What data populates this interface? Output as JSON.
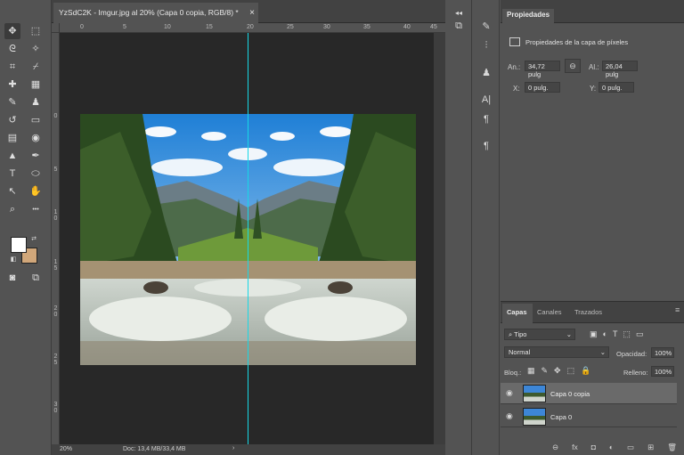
{
  "toolbar": {
    "tools": [
      {
        "id": "move",
        "glyph": "✥"
      },
      {
        "id": "artboard",
        "glyph": "⬚"
      },
      {
        "id": "lasso",
        "glyph": "ᘓ"
      },
      {
        "id": "magic-wand",
        "glyph": "✧"
      },
      {
        "id": "crop",
        "glyph": "⌗"
      },
      {
        "id": "eyedropper",
        "glyph": "⌿"
      },
      {
        "id": "healing",
        "glyph": "✚"
      },
      {
        "id": "patch",
        "glyph": "▦"
      },
      {
        "id": "brush",
        "glyph": "✎"
      },
      {
        "id": "stamp",
        "glyph": "♟"
      },
      {
        "id": "history-brush",
        "glyph": "↺"
      },
      {
        "id": "eraser",
        "glyph": "▭"
      },
      {
        "id": "gradient",
        "glyph": "▤"
      },
      {
        "id": "blur",
        "glyph": "◉"
      },
      {
        "id": "dodge",
        "glyph": "▲"
      },
      {
        "id": "pen",
        "glyph": "✒"
      },
      {
        "id": "type",
        "glyph": "T"
      },
      {
        "id": "shape",
        "glyph": "⬭"
      },
      {
        "id": "path-select",
        "glyph": "↖"
      },
      {
        "id": "hand",
        "glyph": "✋"
      },
      {
        "id": "zoom",
        "glyph": "⌕"
      },
      {
        "id": "more",
        "glyph": "•••"
      }
    ],
    "foreground_color": "#ffffff",
    "background_color": "#d1a77a"
  },
  "document": {
    "tab_title": "YzSdC2K - Imgur.jpg al 20% (Capa 0 copia, RGB/8) *",
    "close_glyph": "×",
    "zoom": "20%",
    "doc_info": "Doc: 13,4 MB/33,4 MB",
    "status_arrow": "›"
  },
  "rulers": {
    "top": [
      "0",
      "5",
      "10",
      "15",
      "20",
      "25",
      "30",
      "35",
      "40",
      "45",
      "50"
    ],
    "left": [
      "0",
      "5",
      "1 0",
      "1 5",
      "2 0",
      "2 5",
      "3 0"
    ]
  },
  "properties": {
    "tab": "Propiedades",
    "header": "Propiedades de la capa de píxeles",
    "w_label": "An.:",
    "w_value": "34,72 pulg",
    "link_glyph": "⊖",
    "h_label": "Al.:",
    "h_value": "26,04 pulg",
    "x_label": "X:",
    "x_value": "0 pulg.",
    "y_label": "Y:",
    "y_value": "0 pulg."
  },
  "layers_panel": {
    "tabs": [
      "Capas",
      "Canales",
      "Trazados"
    ],
    "filter_kind": "Tipo",
    "blend_mode": "Normal",
    "opacity_label": "Opacidad:",
    "opacity_value": "100%",
    "lock_label": "Bloq.:",
    "fill_label": "Relleno:",
    "fill_value": "100%",
    "layers": [
      {
        "name": "Capa 0 copia",
        "selected": true
      },
      {
        "name": "Capa 0",
        "selected": false
      }
    ],
    "footer_icons": [
      "link",
      "fx",
      "mask",
      "adjustment",
      "folder",
      "new-layer",
      "delete"
    ],
    "footer_glyphs": [
      "⊖",
      "fx",
      "◘",
      "◐",
      "▭",
      "⊞",
      "🗑"
    ]
  },
  "colors": {
    "guide": "#17d8e6",
    "canvas": "#282828",
    "panel": "#535353"
  }
}
